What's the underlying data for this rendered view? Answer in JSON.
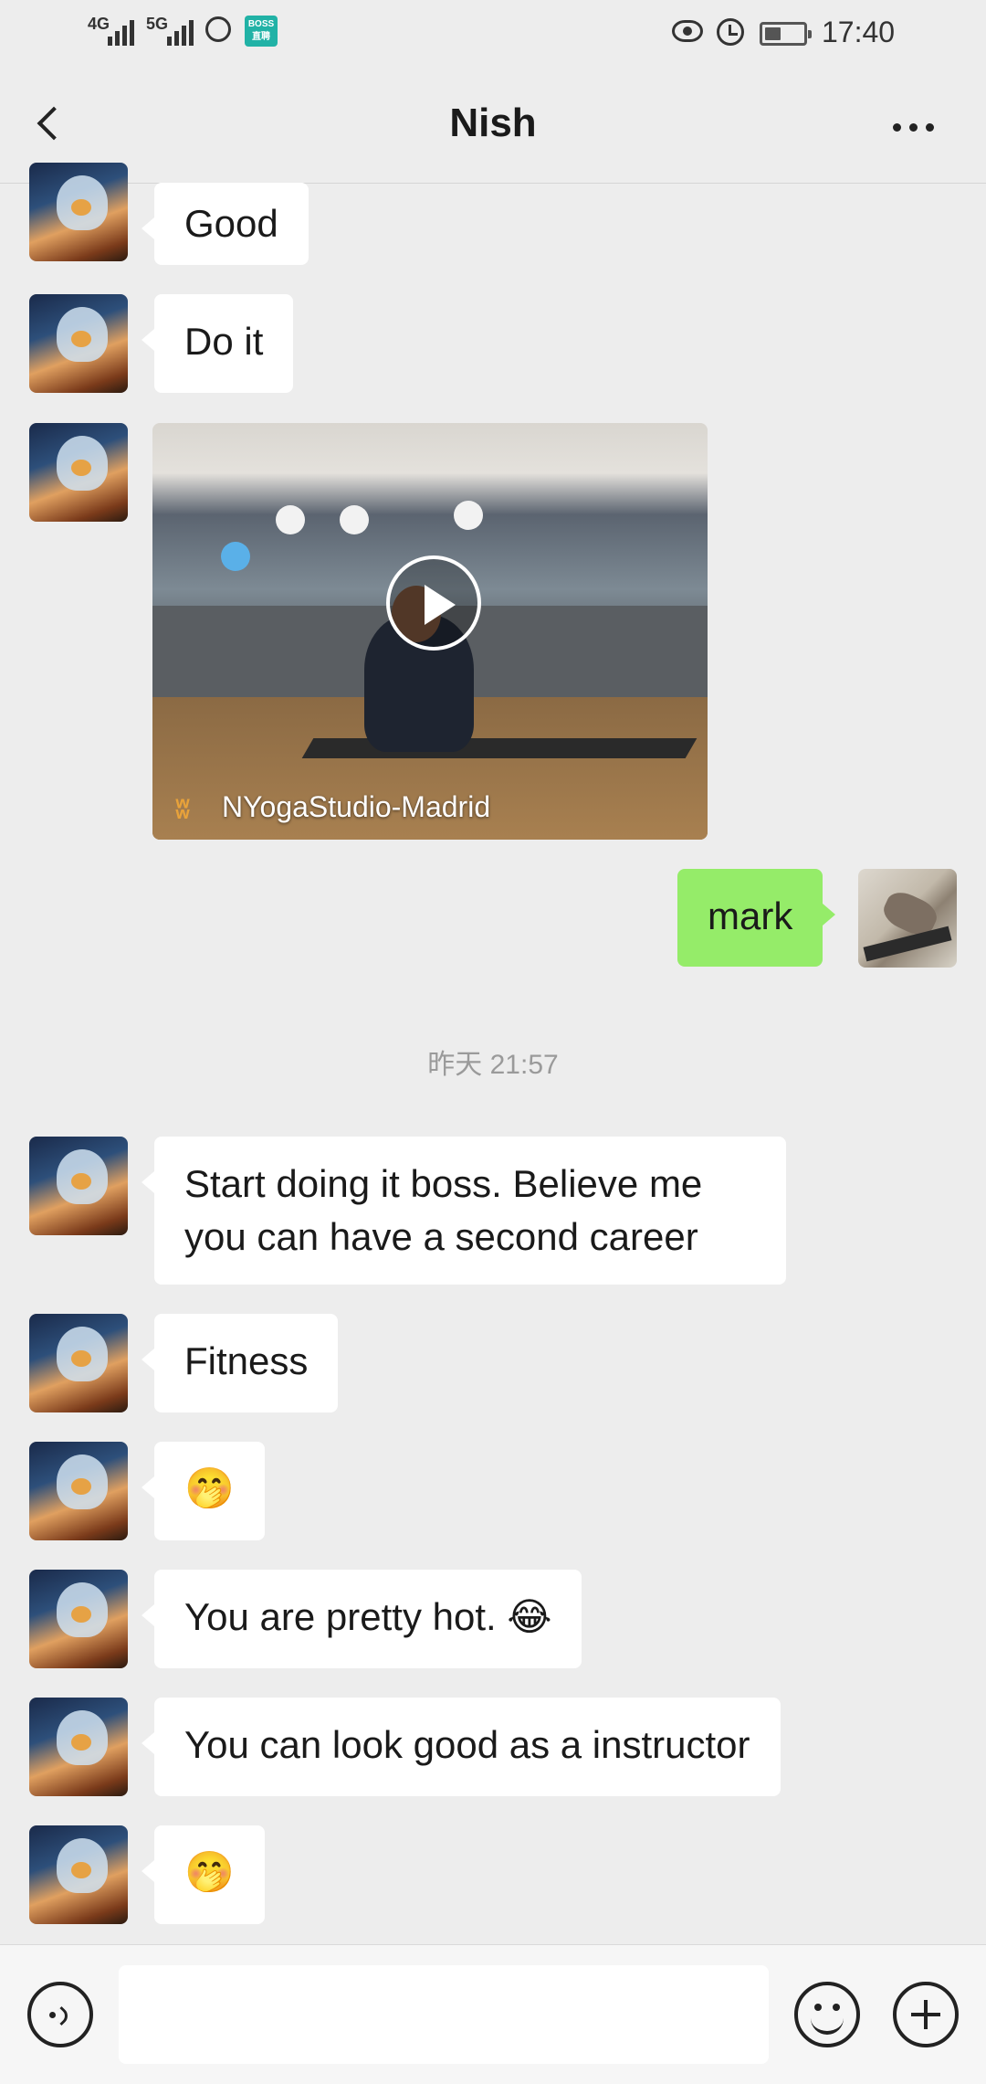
{
  "status_bar": {
    "network_1": "4G",
    "network_2": "5G",
    "boss_app_label": "BOSS\n直聘",
    "time": "17:40"
  },
  "header": {
    "title": "Nish"
  },
  "messages": [
    {
      "sender": "Nish",
      "type": "text",
      "text": "Good"
    },
    {
      "sender": "Nish",
      "type": "text",
      "text": "Do it"
    },
    {
      "sender": "Nish",
      "type": "video",
      "source": "NYogaStudio-Madrid"
    },
    {
      "sender": "me",
      "type": "text",
      "text": "mark"
    },
    {
      "sender": "Nish",
      "type": "text",
      "text": "Start doing it boss. Believe me you can have a second career"
    },
    {
      "sender": "Nish",
      "type": "text",
      "text": "Fitness"
    },
    {
      "sender": "Nish",
      "type": "emoji",
      "text": "🤭"
    },
    {
      "sender": "Nish",
      "type": "text",
      "text": "You are pretty hot. 😂"
    },
    {
      "sender": "Nish",
      "type": "text",
      "text": "You can look good as a instructor"
    },
    {
      "sender": "Nish",
      "type": "emoji",
      "text": "🤭"
    }
  ],
  "timestamp": "昨天 21:57",
  "input_bar": {
    "message_value": "",
    "icons": [
      "voice-icon",
      "emoji-icon",
      "plus-icon"
    ]
  },
  "colors": {
    "background": "#ededed",
    "incoming_bubble": "#ffffff",
    "outgoing_bubble": "#95ec69"
  }
}
